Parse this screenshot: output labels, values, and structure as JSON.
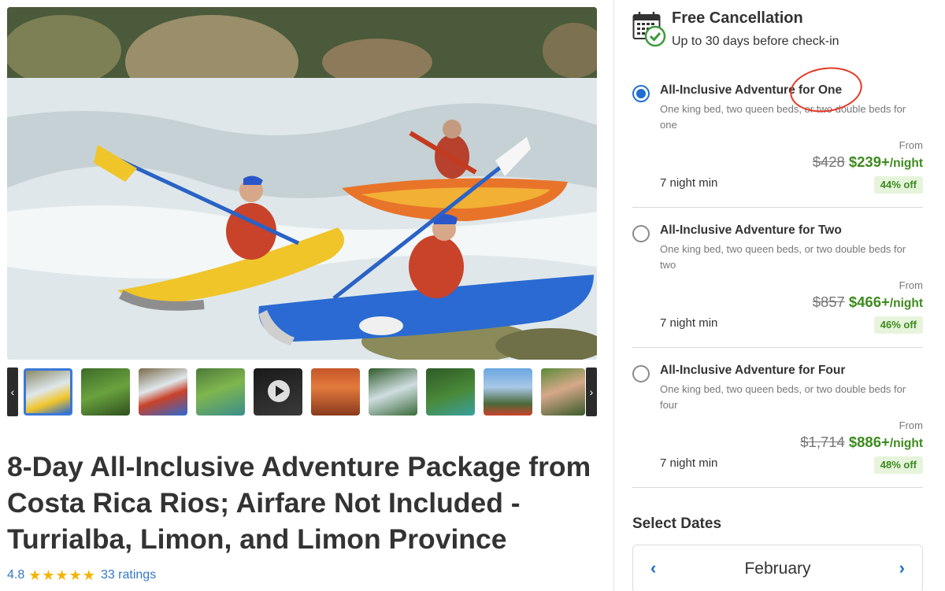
{
  "gallery": {
    "prev_arrow": "‹",
    "next_arrow": "›",
    "thumbnails": [
      "kayak-rapids",
      "zipline-forest",
      "rafting-group",
      "forest-pool",
      "video",
      "lodge-deck",
      "waterfall-swim",
      "jungle-river",
      "volcano-view",
      "hiker-helmet"
    ]
  },
  "listing": {
    "title": "8-Day All-Inclusive Adventure Package from Costa Rica Rios; Airfare Not Included - Turrialba, Limon, and Limon Province",
    "rating": "4.8",
    "stars": "★★★★★",
    "ratings_count": "33 ratings"
  },
  "cancellation": {
    "title": "Free Cancellation",
    "subtitle": "Up to 30 days before check-in"
  },
  "options": [
    {
      "name": "All-Inclusive Adventure for One",
      "description": "One king bed, two queen beds, or two double beds for one",
      "from_label": "From",
      "old_price": "$428",
      "new_price": "$239+",
      "per": "/night",
      "min_nights": "7 night min",
      "discount": "44% off",
      "selected": true
    },
    {
      "name": "All-Inclusive Adventure for Two",
      "description": "One king bed, two queen beds, or two double beds for two",
      "from_label": "From",
      "old_price": "$857",
      "new_price": "$466+",
      "per": "/night",
      "min_nights": "7 night min",
      "discount": "46% off",
      "selected": false
    },
    {
      "name": "All-Inclusive Adventure for Four",
      "description": "One king bed, two queen beds, or two double beds for four",
      "from_label": "From",
      "old_price": "$1,714",
      "new_price": "$886+",
      "per": "/night",
      "min_nights": "7 night min",
      "discount": "48% off",
      "selected": false
    }
  ],
  "dates": {
    "heading": "Select Dates",
    "month": "February",
    "prev": "‹",
    "next": "›"
  },
  "colors": {
    "accent_blue": "#1f6fd1",
    "link_blue": "#3478c6",
    "price_green": "#3d8a1e",
    "discount_bg": "#e6f4dc",
    "star_gold": "#f4b400",
    "annotation_red": "#e53a26"
  }
}
